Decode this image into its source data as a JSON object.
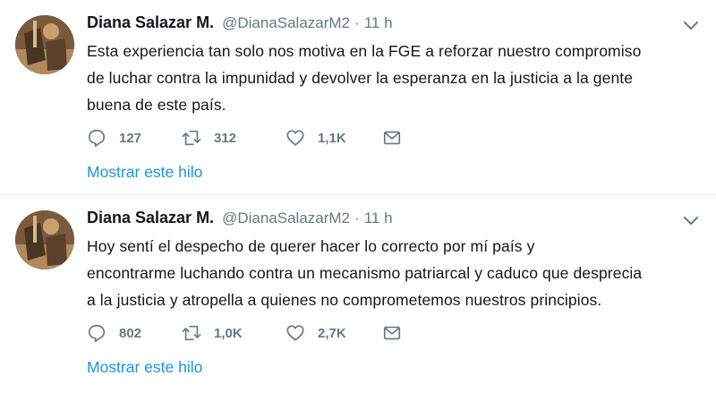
{
  "tweets": [
    {
      "name": "Diana Salazar M.",
      "handle": "@DianaSalazarM2",
      "separator": "·",
      "time": "11 h",
      "lines": [
        "Esta experiencia tan solo nos motiva en la FGE a reforzar nuestro compromiso",
        "de luchar contra la impunidad y devolver la esperanza en la justicia a la gente",
        "buena de este país."
      ],
      "replies": "127",
      "retweets": "312",
      "likes": "1,1K",
      "show_thread": "Mostrar este hilo"
    },
    {
      "name": "Diana Salazar M.",
      "handle": "@DianaSalazarM2",
      "separator": "·",
      "time": "11 h",
      "lines": [
        "Hoy sentí el despecho de querer hacer lo correcto por mí país y",
        "encontrarme luchando contra un mecanismo patriarcal y caduco que desprecia",
        "a la justicia y atropella a quienes no  comprometemos nuestros principios."
      ],
      "replies": "802",
      "retweets": "1,0K",
      "likes": "2,7K",
      "show_thread": "Mostrar este hilo"
    }
  ],
  "icons": {
    "avatar": "avatar-image",
    "menu": "chevron-down-icon",
    "reply": "reply-icon",
    "retweet": "retweet-icon",
    "like": "heart-icon",
    "message": "envelope-icon"
  },
  "colors": {
    "link": "#1b95e0",
    "secondary_text": "#657786",
    "divider": "#e6ecf0"
  }
}
